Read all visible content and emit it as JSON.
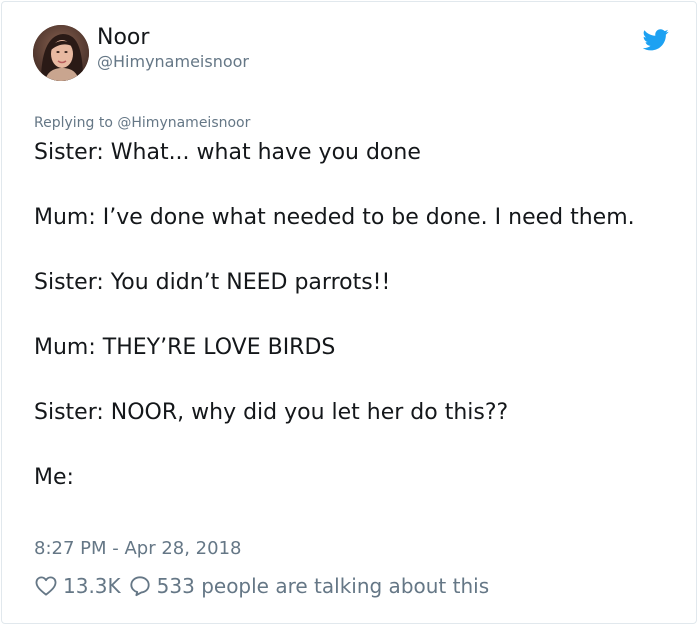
{
  "tweet": {
    "author": {
      "name": "Noor",
      "handle": "@Himynameisnoor"
    },
    "replying_to": {
      "prefix": "Replying to",
      "handle": "@Himynameisnoor"
    },
    "lines": [
      "Sister: What... what have you done",
      "Mum: I’ve done what needed to be done. I need them.",
      "Sister: You didn’t NEED parrots!!",
      "Mum: THEY’RE LOVE BIRDS",
      "Sister: NOOR, why did you let her do this??",
      "Me:"
    ],
    "timestamp": "8:27 PM - Apr 28, 2018",
    "likes": "13.3K",
    "talking": "533 people are talking about this"
  },
  "icons": {
    "brand": "twitter-bird-icon",
    "like": "heart-icon",
    "reply": "comment-bubble-icon"
  },
  "colors": {
    "brand_blue": "#1da1f2",
    "secondary_text": "#657786",
    "primary_text": "#14171a",
    "border": "#e1e8ed"
  }
}
